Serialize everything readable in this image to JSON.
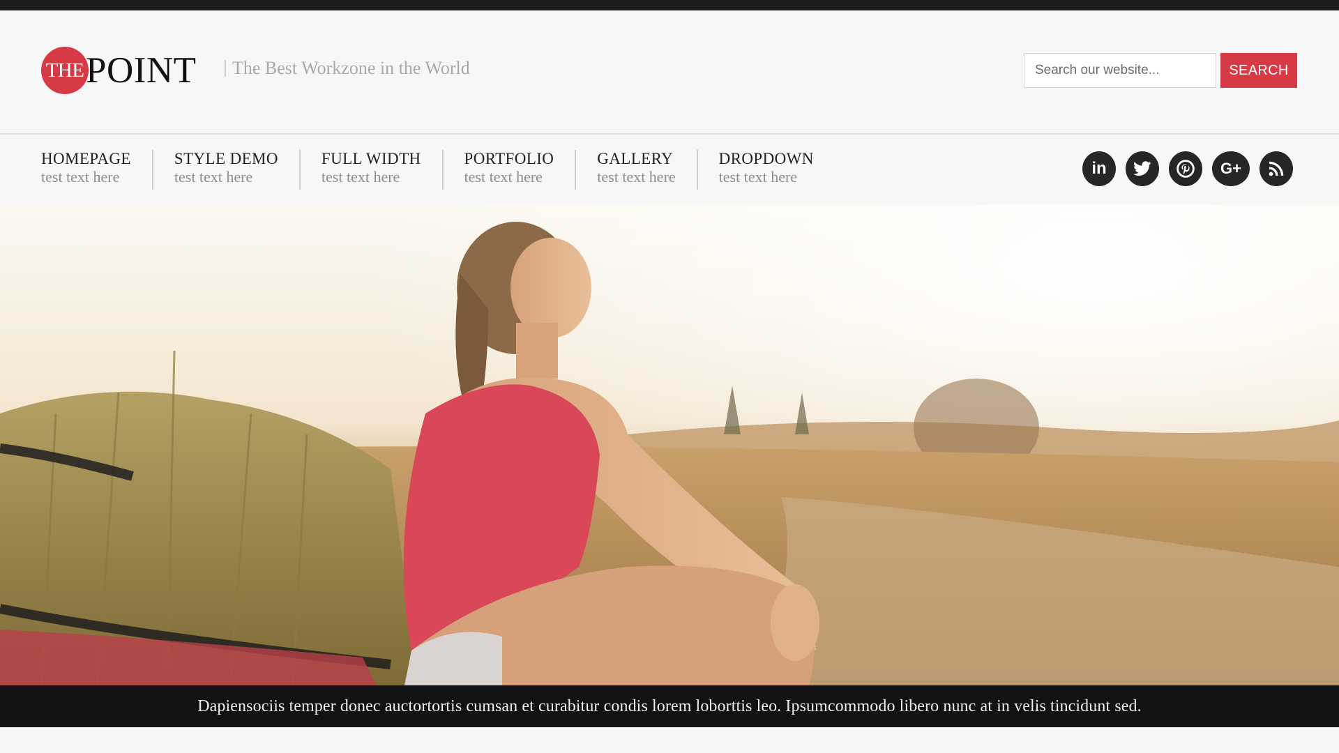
{
  "logo": {
    "circle_text": "THE",
    "word": "POINT"
  },
  "tagline": "The Best Workzone in the World",
  "search": {
    "placeholder": "Search our website...",
    "button_label": "SEARCH"
  },
  "nav": {
    "items": [
      {
        "title": "HOMEPAGE",
        "subtitle": "test text here"
      },
      {
        "title": "STYLE DEMO",
        "subtitle": "test text here"
      },
      {
        "title": "FULL WIDTH",
        "subtitle": "test text here"
      },
      {
        "title": "PORTFOLIO",
        "subtitle": "test text here"
      },
      {
        "title": "GALLERY",
        "subtitle": "test text here"
      },
      {
        "title": "DROPDOWN",
        "subtitle": "test text here"
      }
    ]
  },
  "social": {
    "icons": [
      "linkedin-icon",
      "twitter-icon",
      "pinterest-icon",
      "google-plus-icon",
      "rss-icon"
    ],
    "linkedin_text": "in",
    "googleplus_text": "G+"
  },
  "hero": {
    "caption": "Dapiensociis temper donec auctortortis cumsan et curabitur condis lorem loborttis leo. Ipsumcommodo libero nunc at in velis tincidunt sed."
  },
  "colors": {
    "accent": "#d63b45",
    "dark": "#1d1d1d",
    "social_bg": "#262626"
  }
}
